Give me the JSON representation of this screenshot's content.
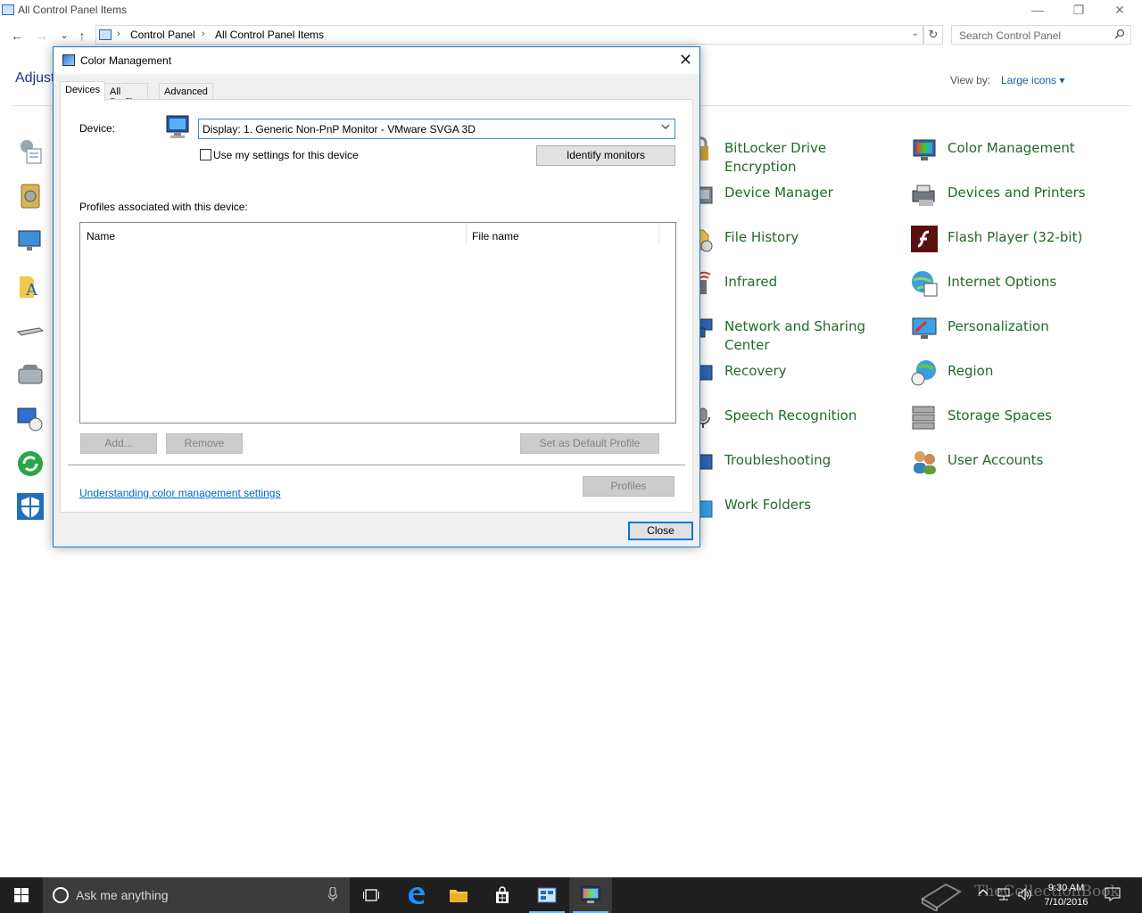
{
  "window": {
    "title": "All Control Panel Items",
    "minimize": "—",
    "restore": "❐",
    "close": "✕"
  },
  "addressbar": {
    "back": "←",
    "forward": "→",
    "recent": "⌄",
    "up": "↑",
    "crumbs": [
      "Control Panel",
      "All Control Panel Items"
    ],
    "separator": "›",
    "dropdown": "⌄",
    "refresh": "↻",
    "search_placeholder": "Search Control Panel"
  },
  "content": {
    "heading": "Adjust",
    "view_by_label": "View by:",
    "view_by_value": "Large icons ▾",
    "items": [
      {
        "label": "BitLocker Drive Encryption",
        "icon": "bitlocker-icon"
      },
      {
        "label": "Color Management",
        "icon": "color-management-icon"
      },
      {
        "label": "Device Manager",
        "icon": "device-manager-icon"
      },
      {
        "label": "Devices and Printers",
        "icon": "devices-printers-icon"
      },
      {
        "label": "File History",
        "icon": "file-history-icon"
      },
      {
        "label": "Flash Player (32-bit)",
        "icon": "flash-player-icon"
      },
      {
        "label": "Infrared",
        "icon": "infrared-icon"
      },
      {
        "label": "Internet Options",
        "icon": "internet-options-icon"
      },
      {
        "label": "Network and Sharing Center",
        "icon": "network-icon"
      },
      {
        "label": "Personalization",
        "icon": "personalization-icon"
      },
      {
        "label": "Recovery",
        "icon": "recovery-icon"
      },
      {
        "label": "Region",
        "icon": "region-icon"
      },
      {
        "label": "Speech Recognition",
        "icon": "speech-icon"
      },
      {
        "label": "Storage Spaces",
        "icon": "storage-spaces-icon"
      },
      {
        "label": "Troubleshooting",
        "icon": "troubleshooting-icon"
      },
      {
        "label": "User Accounts",
        "icon": "user-accounts-icon"
      },
      {
        "label": "Work Folders",
        "icon": "work-folders-icon"
      }
    ]
  },
  "dialog": {
    "title": "Color Management",
    "close_glyph": "✕",
    "tabs": [
      "Devices",
      "All Profiles",
      "Advanced"
    ],
    "active_tab": "Devices",
    "device_label": "Device:",
    "device_value": "Display: 1. Generic Non-PnP Monitor - VMware SVGA 3D",
    "use_settings_label": "Use my settings for this device",
    "use_settings_checked": false,
    "identify_button": "Identify monitors",
    "profiles_label": "Profiles associated with this device:",
    "columns": [
      "Name",
      "File name"
    ],
    "add_button": "Add...",
    "remove_button": "Remove",
    "default_button": "Set as Default Profile",
    "link_text": "Understanding color management settings",
    "profiles_button": "Profiles",
    "close_button": "Close"
  },
  "taskbar": {
    "search_text": "Ask me anything",
    "time": "9:30 AM",
    "date": "7/10/2016",
    "watermark": "TheCollectionBook"
  },
  "colors": {
    "link_green": "#1e6b27",
    "accent_blue": "#0078d7",
    "taskbar": "#1f1f1f"
  }
}
